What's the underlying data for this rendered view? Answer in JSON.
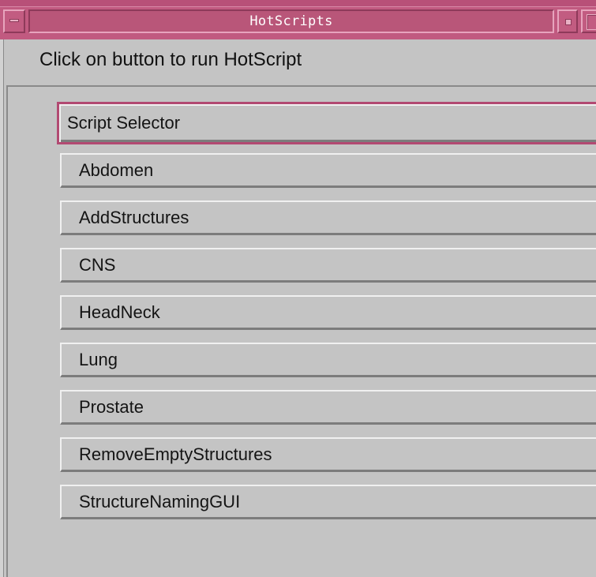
{
  "window": {
    "title": "HotScripts"
  },
  "instruction": "Click on button to run HotScript",
  "selector": {
    "label": "Script Selector"
  },
  "scripts": [
    {
      "label": "Abdomen"
    },
    {
      "label": "AddStructures"
    },
    {
      "label": "CNS"
    },
    {
      "label": "HeadNeck"
    },
    {
      "label": "Lung"
    },
    {
      "label": "Prostate"
    },
    {
      "label": "RemoveEmptyStructures"
    },
    {
      "label": "StructureNamingGUI"
    }
  ],
  "colors": {
    "titlebar": "#c15a80",
    "background": "#c4c4c4",
    "focus_border": "#b24a72"
  }
}
